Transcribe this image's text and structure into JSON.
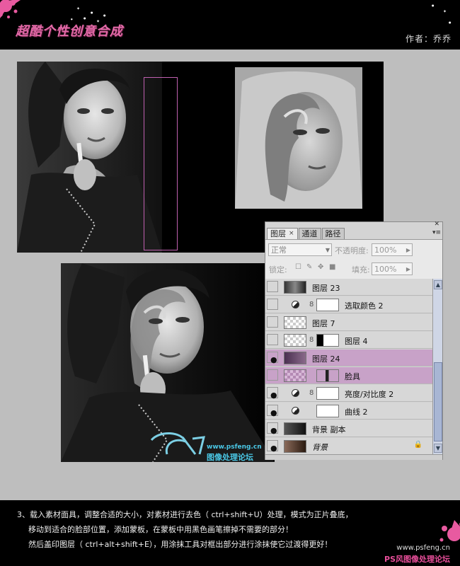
{
  "header": {
    "title": "超酷个性创意合成",
    "author": "作者：乔乔"
  },
  "layers_panel": {
    "tabs": [
      {
        "label": "图层",
        "close": "×"
      },
      {
        "label": "通道"
      },
      {
        "label": "路径"
      }
    ],
    "blend_mode": "正常",
    "opacity_label": "不透明度:",
    "opacity_value": "100%",
    "lock_label": "锁定:",
    "fill_label": "填充:",
    "fill_value": "100%",
    "layers": [
      {
        "name": "图层 23"
      },
      {
        "name": "选取颜色 2"
      },
      {
        "name": "图层 7"
      },
      {
        "name": "图层 4"
      },
      {
        "name": "图层 24"
      },
      {
        "name": "脸具"
      },
      {
        "name": "亮度/对比度 2"
      },
      {
        "name": "曲线 2"
      },
      {
        "name": "背景 副本"
      },
      {
        "name": "背景"
      }
    ]
  },
  "watermark": {
    "url": "www.psfeng.cn",
    "name": "图像处理论坛"
  },
  "instructions": {
    "line1": "3、载入素材面具，调整合适的大小，对素材进行去色（ ctrl+shift+U）处理，模式为正片叠底，",
    "line2": "移动到适合的脸部位置，添加蒙板，在蒙板中用黑色画笔擦掉不需要的部分！",
    "line3": "然后盖印图层（ ctrl+alt+shift+E），用涂抹工具对框出部分进行涂抹使它过渡得更好！"
  },
  "footer": {
    "url": "www.psfeng.cn",
    "name": "PS风图像处理论坛"
  },
  "colors": {
    "title": "#e36aa8",
    "highlight_row": "#c8a2c8",
    "selection_rect": "#c060b0",
    "watermark": "#4ac6e4",
    "footer_brand": "#e84e9a"
  }
}
